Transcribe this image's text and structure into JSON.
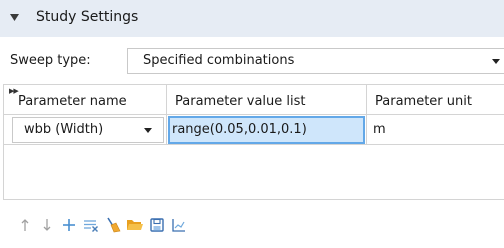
{
  "section": {
    "title": "Study Settings",
    "expanded": true
  },
  "sweep": {
    "label": "Sweep type:",
    "value": "Specified combinations"
  },
  "table": {
    "headers": [
      "Parameter name",
      "Parameter value list",
      "Parameter unit"
    ],
    "rows": [
      {
        "name": "wbb (Width)",
        "value_list": "range(0.05,0.01,0.1)",
        "unit": "m"
      }
    ]
  },
  "toolbar": {
    "buttons": [
      {
        "icon": "move-up-icon"
      },
      {
        "icon": "move-down-icon"
      },
      {
        "icon": "add-icon"
      },
      {
        "icon": "delete-icon"
      },
      {
        "icon": "clear-table-icon"
      },
      {
        "icon": "load-from-file-icon"
      },
      {
        "icon": "save-to-file-icon"
      },
      {
        "icon": "plot-icon"
      }
    ]
  },
  "colors": {
    "header_bg": "#e6ecf4",
    "selected_cell_bg": "#cfe6fb",
    "selected_cell_border": "#63a8e8",
    "toolbar_icon": "#5a9bd4",
    "folder_icon": "#f0a830"
  }
}
